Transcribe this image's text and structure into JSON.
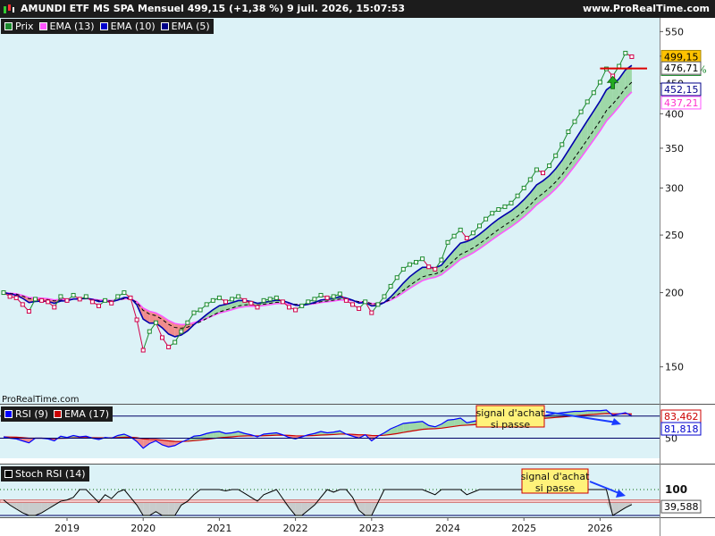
{
  "header": {
    "title": "AMUNDI ETF MS SPA Mensuel 499,15 (+1,38 %) 9 juil. 2026, 15:07:53",
    "site": "www.ProRealTime.com"
  },
  "legend_main": [
    {
      "label": "Prix",
      "color": "#1b8a2e",
      "icon": "candle-icon"
    },
    {
      "label": "EMA (13)",
      "color": "#ff55ff"
    },
    {
      "label": "EMA (10)",
      "color": "#0000cc"
    },
    {
      "label": "EMA (5)",
      "color": "#000088"
    }
  ],
  "legend_rsi": [
    {
      "label": "RSI (9)",
      "color": "#0000ff"
    },
    {
      "label": "EMA (17)",
      "color": "#cc0000"
    }
  ],
  "legend_stoch": [
    {
      "label": "Stoch RSI (14)",
      "color": "#000000"
    }
  ],
  "watermark": "ProRealTime.com",
  "price_tags": {
    "last": "499,15",
    "change": "+1,38 %",
    "level": "476,71",
    "ema10": "452,15",
    "ema13": "437,21"
  },
  "rsi_tags": {
    "rsi": "83,462",
    "ema": "81,818"
  },
  "stoch_tags": {
    "value": "39,588"
  },
  "annotations": {
    "rsi_note": "signal d'achat\nsi passe",
    "stoch_note": "signal d'achat\nsi passe"
  },
  "colors": {
    "background": "#ffffff",
    "panel_bg": "#dcf2f7",
    "up": "#1b8a2e",
    "down": "#d0004a",
    "fill_bull": "#9ed8a8",
    "fill_bear": "#f08c8c",
    "note_bg": "#fff27a"
  },
  "chart_data": {
    "type": "line",
    "title": "AMUNDI ETF MS SPA Mensuel",
    "scale": "log",
    "x_tick_labels": [
      "2019",
      "2020",
      "2021",
      "2022",
      "2023",
      "2024",
      "2025",
      "2026"
    ],
    "price_axis": {
      "ticks": [
        150,
        200,
        250,
        300,
        350,
        400,
        450,
        500,
        550
      ],
      "ylim": [
        130,
        580
      ]
    },
    "price_series": [
      {
        "name": "Prix",
        "close": [
          200,
          197,
          196,
          191,
          186,
          195,
          194,
          193,
          189,
          197,
          194,
          198,
          195,
          197,
          193,
          190,
          194,
          192,
          197,
          200,
          196,
          180,
          160,
          172,
          178,
          168,
          162,
          165,
          172,
          178,
          185,
          187,
          191,
          194,
          196,
          193,
          195,
          197,
          194,
          192,
          189,
          194,
          195,
          196,
          193,
          189,
          187,
          190,
          193,
          195,
          198,
          196,
          197,
          199,
          194,
          191,
          188,
          193,
          185,
          191,
          197,
          205,
          212,
          219,
          223,
          225,
          228,
          221,
          219,
          227,
          243,
          249,
          255,
          247,
          252,
          259,
          266,
          272,
          276,
          279,
          283,
          291,
          300,
          310,
          322,
          318,
          327,
          340,
          355,
          373,
          388,
          403,
          419,
          434,
          452,
          476,
          463,
          481,
          506,
          499
        ]
      },
      {
        "name": "EMA (13)"
      },
      {
        "name": "EMA (10)"
      },
      {
        "name": "EMA (5)"
      }
    ],
    "price_extra_points": [
      {
        "date": "2026-02",
        "value": 463
      },
      {
        "date": "2026-03",
        "value": 481
      }
    ],
    "rsi": {
      "axis_ticks": [
        50
      ],
      "series": [
        {
          "name": "RSI (9)",
          "last": 83.462
        },
        {
          "name": "EMA (17)",
          "last": 81.818
        }
      ],
      "values": [
        52,
        50,
        49,
        46,
        43,
        50,
        50,
        49,
        46,
        53,
        51,
        54,
        52,
        53,
        50,
        48,
        51,
        50,
        54,
        56,
        52,
        45,
        35,
        42,
        46,
        40,
        37,
        39,
        44,
        48,
        53,
        54,
        57,
        59,
        60,
        57,
        58,
        60,
        57,
        55,
        52,
        56,
        57,
        58,
        55,
        51,
        49,
        52,
        55,
        57,
        60,
        58,
        59,
        61,
        56,
        53,
        50,
        55,
        46,
        53,
        58,
        64,
        68,
        72,
        73,
        74,
        75,
        69,
        67,
        71,
        77,
        78,
        80,
        73,
        75,
        77,
        79,
        80,
        80,
        81,
        82,
        84,
        85,
        86,
        87,
        83,
        85,
        87,
        88,
        89,
        90,
        90,
        91,
        91,
        91,
        92,
        84,
        86,
        88,
        83
      ]
    },
    "stoch_rsi": {
      "axis_ticks": [
        100
      ],
      "series": [
        {
          "name": "Stoch RSI (14)",
          "last": 39.588
        }
      ],
      "values": [
        60,
        40,
        25,
        10,
        0,
        0,
        10,
        25,
        40,
        55,
        60,
        70,
        100,
        100,
        75,
        50,
        80,
        65,
        90,
        100,
        70,
        40,
        0,
        0,
        15,
        0,
        0,
        0,
        40,
        55,
        80,
        100,
        100,
        100,
        100,
        95,
        100,
        100,
        85,
        70,
        55,
        80,
        90,
        100,
        65,
        30,
        0,
        0,
        20,
        40,
        70,
        100,
        90,
        100,
        100,
        70,
        20,
        0,
        0,
        50,
        100,
        100,
        100,
        100,
        100,
        100,
        100,
        90,
        80,
        100,
        100,
        100,
        100,
        80,
        90,
        100,
        100,
        100,
        100,
        100,
        100,
        100,
        100,
        100,
        100,
        90,
        100,
        100,
        100,
        100,
        100,
        100,
        100,
        100,
        100,
        100,
        0,
        15,
        30,
        42
      ]
    },
    "dates": [
      "2018-03",
      "2018-04",
      "2018-05",
      "2018-06",
      "2018-07",
      "2018-08",
      "2018-09",
      "2018-10",
      "2018-11",
      "2018-12",
      "2019-01",
      "2019-02",
      "2019-03",
      "2019-04",
      "2019-05",
      "2019-06",
      "2019-07",
      "2019-08",
      "2019-09",
      "2019-10",
      "2019-11",
      "2019-12",
      "2020-01",
      "2020-02",
      "2020-03",
      "2020-04",
      "2020-05",
      "2020-06",
      "2020-07",
      "2020-08",
      "2020-09",
      "2020-10",
      "2020-11",
      "2020-12",
      "2021-01",
      "2021-02",
      "2021-03",
      "2021-04",
      "2021-05",
      "2021-06",
      "2021-07",
      "2021-08",
      "2021-09",
      "2021-10",
      "2021-11",
      "2021-12",
      "2022-01",
      "2022-02",
      "2022-03",
      "2022-04",
      "2022-05",
      "2022-06",
      "2022-07",
      "2022-08",
      "2022-09",
      "2022-10",
      "2022-11",
      "2022-12",
      "2023-01",
      "2023-02",
      "2023-03",
      "2023-04",
      "2023-05",
      "2023-06",
      "2023-07",
      "2023-08",
      "2023-09",
      "2023-10",
      "2023-11",
      "2023-12",
      "2024-01",
      "2024-02",
      "2024-03",
      "2024-04",
      "2024-05",
      "2024-06",
      "2024-07",
      "2024-08",
      "2024-09",
      "2024-10",
      "2024-11",
      "2024-12",
      "2025-01",
      "2025-02",
      "2025-03",
      "2025-04",
      "2025-05",
      "2025-06",
      "2025-07",
      "2025-08",
      "2025-09",
      "2025-10",
      "2025-11",
      "2025-12",
      "2026-01",
      "2026-02",
      "2026-03",
      "2026-04",
      "2026-05",
      "2026-06"
    ],
    "horizontal_level": 476.71
  }
}
